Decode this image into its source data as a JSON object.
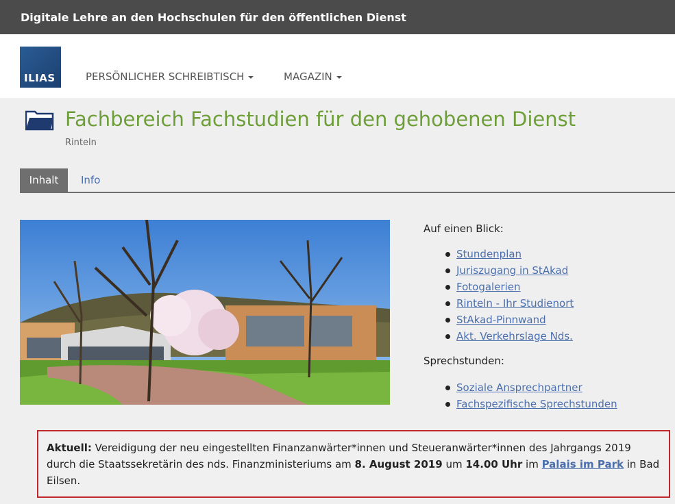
{
  "topbar": {
    "title": "Digitale Lehre an den Hochschulen für den öffentlichen Dienst"
  },
  "logo": {
    "text": "ILIAS"
  },
  "nav": {
    "items": [
      {
        "label": "PERSÖNLICHER SCHREIBTISCH"
      },
      {
        "label": "MAGAZIN"
      }
    ]
  },
  "header": {
    "icon": "folder-icon",
    "title": "Fachbereich Fachstudien für den gehobenen Dienst",
    "subtitle": "Rinteln"
  },
  "tabs": [
    {
      "label": "Inhalt",
      "active": true
    },
    {
      "label": "Info",
      "active": false
    }
  ],
  "glance": {
    "heading": "Auf einen Blick:",
    "links": [
      "Stundenplan",
      "Juriszugang in StAkad",
      "Fotogalerien",
      "Rinteln - Ihr Studienort",
      "StAkad-Pinnwand",
      "Akt. Verkehrslage Nds."
    ]
  },
  "office_hours": {
    "heading": "Sprechstunden:",
    "links": [
      "Soziale Ansprechpartner",
      "Fachspezifische Sprechstunden"
    ]
  },
  "notice": {
    "label": "Aktuell:",
    "text1": " Vereidigung der neu eingestellten Finanzanwärter*innen und Steueranwärter*innen des Jahrgangs 2019 durch die Staatssekretärin des nds. Finanzministeriums am ",
    "date": "8. August 2019",
    "text2": " um ",
    "time": "14.00 Uhr",
    "text3": " im ",
    "link": "Palais im Park",
    "text4": " in Bad Eilsen."
  },
  "colors": {
    "title_green": "#6e9e3a",
    "link_blue": "#4b6fae",
    "notice_border": "#c0272d",
    "topbar": "#4b4b4b"
  }
}
